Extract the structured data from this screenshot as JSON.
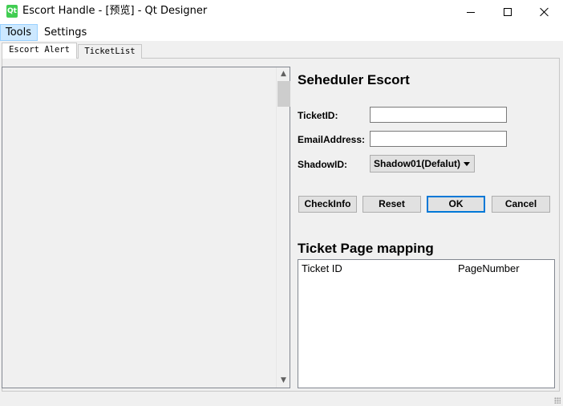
{
  "window": {
    "title": "Escort Handle - [预览] - Qt Designer",
    "icon": "qt-logo-icon",
    "icon_text": "Qt",
    "controls": [
      "minimize-icon",
      "maximize-icon",
      "close-icon"
    ]
  },
  "menubar": {
    "items": [
      {
        "label": "Tools",
        "highlighted": true
      },
      {
        "label": "Settings",
        "highlighted": false
      }
    ]
  },
  "tabs": [
    {
      "label": "Escort Alert",
      "active": true
    },
    {
      "label": "TicketList",
      "active": false
    }
  ],
  "scheduler": {
    "title": "Seheduler Escort",
    "ticket_id_label": "TicketID:",
    "ticket_id_value": "",
    "email_label": "EmailAddress:",
    "email_value": "",
    "shadow_label": "ShadowID:",
    "shadow_selected": "Shadow01(Defalut)"
  },
  "buttons": {
    "checkinfo": "CheckInfo",
    "reset": "Reset",
    "ok": "OK",
    "cancel": "Cancel"
  },
  "mapping": {
    "title": "Ticket Page mapping",
    "columns": [
      "Ticket ID",
      "PageNumber"
    ],
    "rows": []
  },
  "colors": {
    "accent": "#0078d7",
    "menu_highlight": "#cce8ff",
    "qt_green": "#41cd52"
  }
}
